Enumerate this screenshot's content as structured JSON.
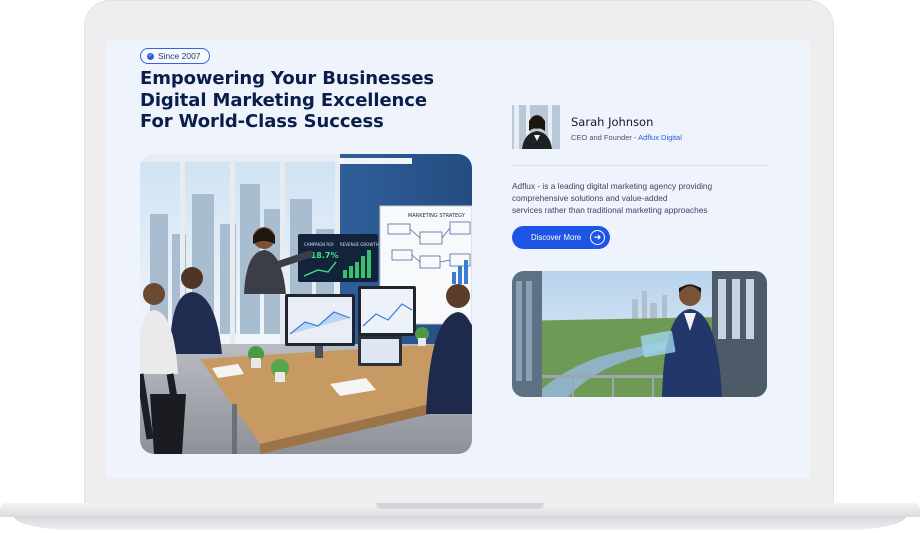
{
  "hero": {
    "badge_label": "Since 2007",
    "headline_lines": [
      "Empowering Your Businesses",
      "Digital Marketing Excellence",
      "For World-Class Success"
    ]
  },
  "office_image": {
    "whiteboard_title": "MARKETING STRATEGY",
    "screen_label_1": "CAMPAIGN ROI",
    "screen_value": "+18.7%",
    "screen_label_2": "REVENUE GROWTH"
  },
  "profile": {
    "name": "Sarah Johnson",
    "role_prefix": "CEO and Founder - ",
    "company": "Adflux Digital"
  },
  "description_lines": [
    "Adflux - is a leading digital marketing agency providing",
    "comprehensive solutions and value-added",
    "services rather than traditional marketing approaches"
  ],
  "cta": {
    "label": "Discover More",
    "icon": "arrow-right-icon"
  },
  "colors": {
    "primary": "#1f55e6",
    "heading": "#0b1d4a",
    "background": "#eef3fc"
  }
}
